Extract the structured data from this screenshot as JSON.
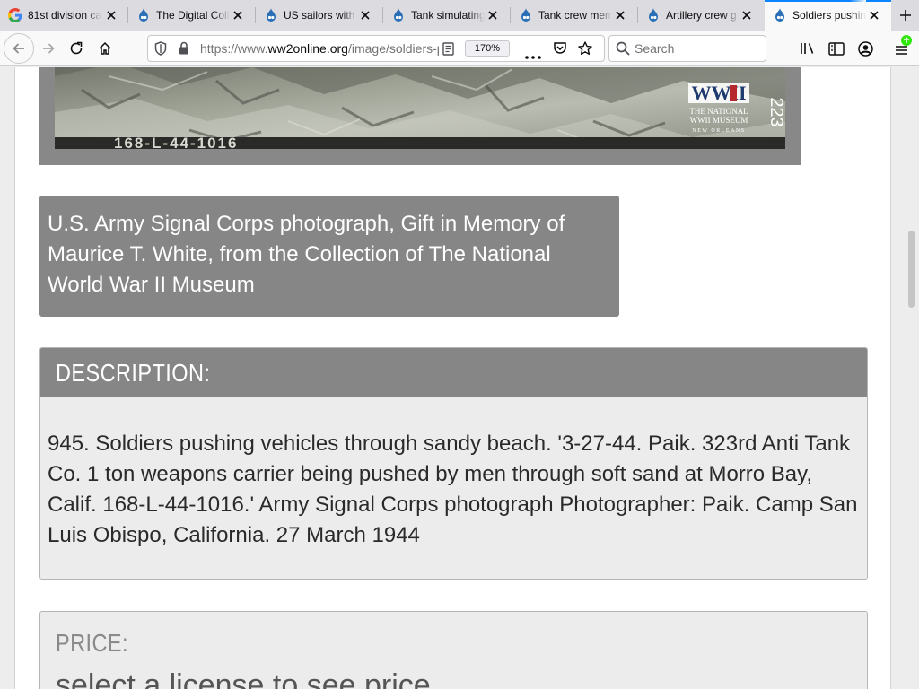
{
  "browser": {
    "tabs": [
      {
        "title": "81st division ca",
        "favicon": "google-favicon",
        "active": false
      },
      {
        "title": "The Digital Coll",
        "favicon": "drupal-favicon",
        "active": false
      },
      {
        "title": "US sailors with",
        "favicon": "drupal-favicon",
        "active": false
      },
      {
        "title": "Tank simulating",
        "favicon": "drupal-favicon",
        "active": false
      },
      {
        "title": "Tank crew mem",
        "favicon": "drupal-favicon",
        "active": false
      },
      {
        "title": "Artillery crew g",
        "favicon": "drupal-favicon",
        "active": false
      },
      {
        "title": "Soldiers pushin",
        "favicon": "drupal-favicon",
        "active": true
      }
    ],
    "url": {
      "scheme": "https://www.",
      "host": "ww2online.org",
      "path": "/image/soldiers-pushing"
    },
    "zoom": "170%",
    "search_placeholder": "Search",
    "accent_color": "#0a84ff",
    "update_badge_color": "#30e60b"
  },
  "photo": {
    "negative_number": "168-L-44-1016",
    "corner_mark": "223",
    "museum_logo": {
      "wordmark": "WWII",
      "line1": "THE NATIONAL",
      "line2": "WWII MUSEUM",
      "line3": "NEW ORLEANS"
    }
  },
  "caption": "U.S. Army Signal Corps photograph, Gift in Memory of Maurice T. White, from the Collection of The National World War II Museum",
  "description": {
    "heading": "DESCRIPTION:",
    "body": "945. Soldiers pushing vehicles through sandy beach. '3-27-44. Paik. 323rd Anti Tank Co. 1 ton weapons carrier being pushed by men through soft sand at Morro Bay, Calif. 168-L-44-1016.' Army Signal Corps photograph Photographer: Paik. Camp San Luis Obispo, California. 27 March 1944"
  },
  "price": {
    "heading": "PRICE:",
    "message": "select a license to see price"
  }
}
